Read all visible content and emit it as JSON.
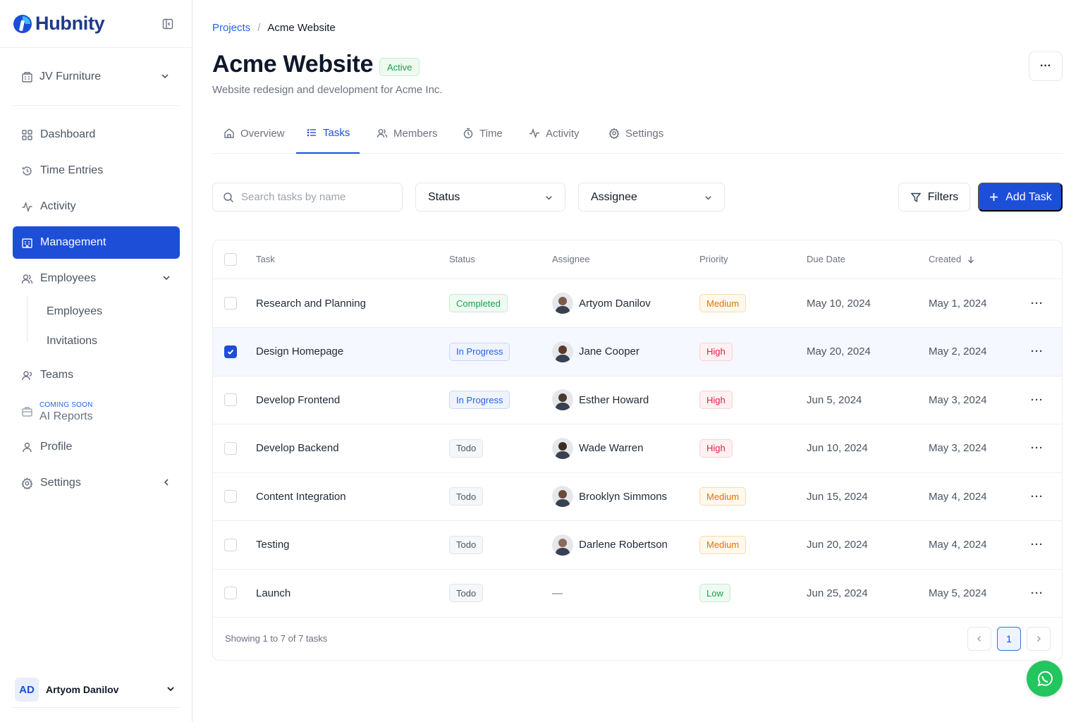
{
  "brand": {
    "name": "Hubnity"
  },
  "sidebar": {
    "org": "JV Furniture",
    "items": [
      {
        "label": "Dashboard",
        "icon": "grid-icon"
      },
      {
        "label": "Time Entries",
        "icon": "history-icon"
      },
      {
        "label": "Activity",
        "icon": "activity-icon"
      },
      {
        "label": "Management",
        "icon": "building-icon",
        "active": true
      },
      {
        "label": "Employees",
        "icon": "users-icon"
      },
      {
        "label": "Teams",
        "icon": "team-icon"
      },
      {
        "label": "Profile",
        "icon": "user-icon"
      },
      {
        "label": "Settings",
        "icon": "gear-icon"
      }
    ],
    "sub_items": [
      "Employees",
      "Invitations"
    ],
    "ai_reports": {
      "tag": "COMING SOON",
      "label": "AI Reports"
    },
    "user": {
      "initials": "AD",
      "name": "Artyom Danilov"
    }
  },
  "breadcrumb": {
    "parent": "Projects",
    "separator": "/",
    "current": "Acme Website"
  },
  "project": {
    "title": "Acme Website",
    "status": "Active",
    "description": "Website redesign and development for Acme Inc."
  },
  "tabs": [
    "Overview",
    "Tasks",
    "Members",
    "Time",
    "Activity",
    "Settings"
  ],
  "active_tab": "Tasks",
  "toolbar": {
    "search_placeholder": "Search tasks by name",
    "status_label": "Status",
    "assignee_label": "Assignee",
    "filters_label": "Filters",
    "add_label": "Add Task"
  },
  "table": {
    "columns": [
      "Task",
      "Status",
      "Assignee",
      "Priority",
      "Due Date",
      "Created"
    ],
    "rows": [
      {
        "task": "Research and Planning",
        "status": "Completed",
        "assignee": "Artyom Danilov",
        "priority": "Medium",
        "due": "May 10, 2024",
        "created": "May 1, 2024",
        "checked": false
      },
      {
        "task": "Design Homepage",
        "status": "In Progress",
        "assignee": "Jane Cooper",
        "priority": "High",
        "due": "May 20, 2024",
        "created": "May 2, 2024",
        "checked": true
      },
      {
        "task": "Develop Frontend",
        "status": "In Progress",
        "assignee": "Esther Howard",
        "priority": "High",
        "due": "Jun 5, 2024",
        "created": "May 3, 2024",
        "checked": false
      },
      {
        "task": "Develop Backend",
        "status": "Todo",
        "assignee": "Wade Warren",
        "priority": "High",
        "due": "Jun 10, 2024",
        "created": "May 3, 2024",
        "checked": false
      },
      {
        "task": "Content Integration",
        "status": "Todo",
        "assignee": "Brooklyn Simmons",
        "priority": "Medium",
        "due": "Jun 15, 2024",
        "created": "May 4, 2024",
        "checked": false
      },
      {
        "task": "Testing",
        "status": "Todo",
        "assignee": "Darlene Robertson",
        "priority": "Medium",
        "due": "Jun 20, 2024",
        "created": "May 4, 2024",
        "checked": false
      },
      {
        "task": "Launch",
        "status": "Todo",
        "assignee": "—",
        "priority": "Low",
        "due": "Jun 25, 2024",
        "created": "May 5, 2024",
        "checked": false
      }
    ],
    "footer": "Showing 1 to 7 of 7 tasks",
    "current_page": "1"
  },
  "colors": {
    "primary": "#1d4ed8",
    "whatsapp": "#22c55e"
  }
}
